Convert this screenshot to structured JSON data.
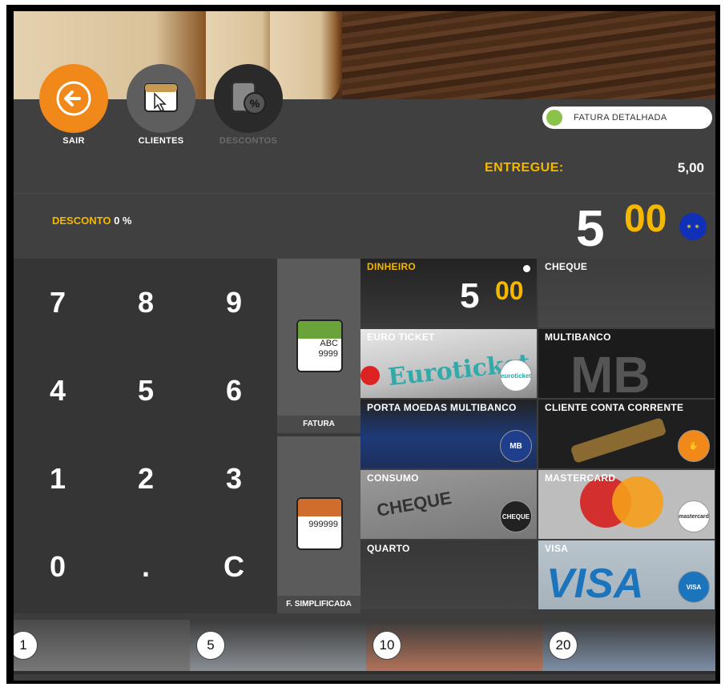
{
  "toolbar": {
    "exit_label": "SAIR",
    "clients_label": "CLIENTES",
    "discounts_label": "DESCONTOS",
    "detailed_invoice_label": "FATURA DETALHADA",
    "accent_color": "#f0891a"
  },
  "summary": {
    "delivered_label": "ENTREGUE:",
    "delivered_value": "5,00",
    "discount_label": "DESCONTO",
    "discount_value": "0 %",
    "total_int": "5",
    "total_dec": "00",
    "currency_icon": "euro-flag-icon"
  },
  "keypad": {
    "keys": [
      "7",
      "8",
      "9",
      "4",
      "5",
      "6",
      "1",
      "2",
      "3",
      "0",
      ".",
      "C"
    ]
  },
  "documents": [
    {
      "label": "FATURA",
      "icon_text_1": "ABC",
      "icon_text_2": "9999",
      "color": "#6aa33a"
    },
    {
      "label": "F. SIMPLIFICADA",
      "icon_text_1": "",
      "icon_text_2": "999999",
      "color": "#d06d2c"
    }
  ],
  "payments": [
    {
      "name": "DINHEIRO",
      "selected": true,
      "amount_int": "5",
      "amount_dec": "00"
    },
    {
      "name": "CHEQUE"
    },
    {
      "name": "EURO TICKET",
      "badge": "euroticket"
    },
    {
      "name": "MULTIBANCO"
    },
    {
      "name": "PORTA MOEDAS MULTIBANCO",
      "badge": "MB"
    },
    {
      "name": "CLIENTE CONTA CORRENTE"
    },
    {
      "name": "CONSUMO",
      "badge": "CHEQUE"
    },
    {
      "name": "MASTERCARD",
      "badge": "mastercard"
    },
    {
      "name": "QUARTO"
    },
    {
      "name": "VISA",
      "badge": "VISA"
    }
  ],
  "denominations": [
    "1",
    "5",
    "10",
    "20"
  ]
}
